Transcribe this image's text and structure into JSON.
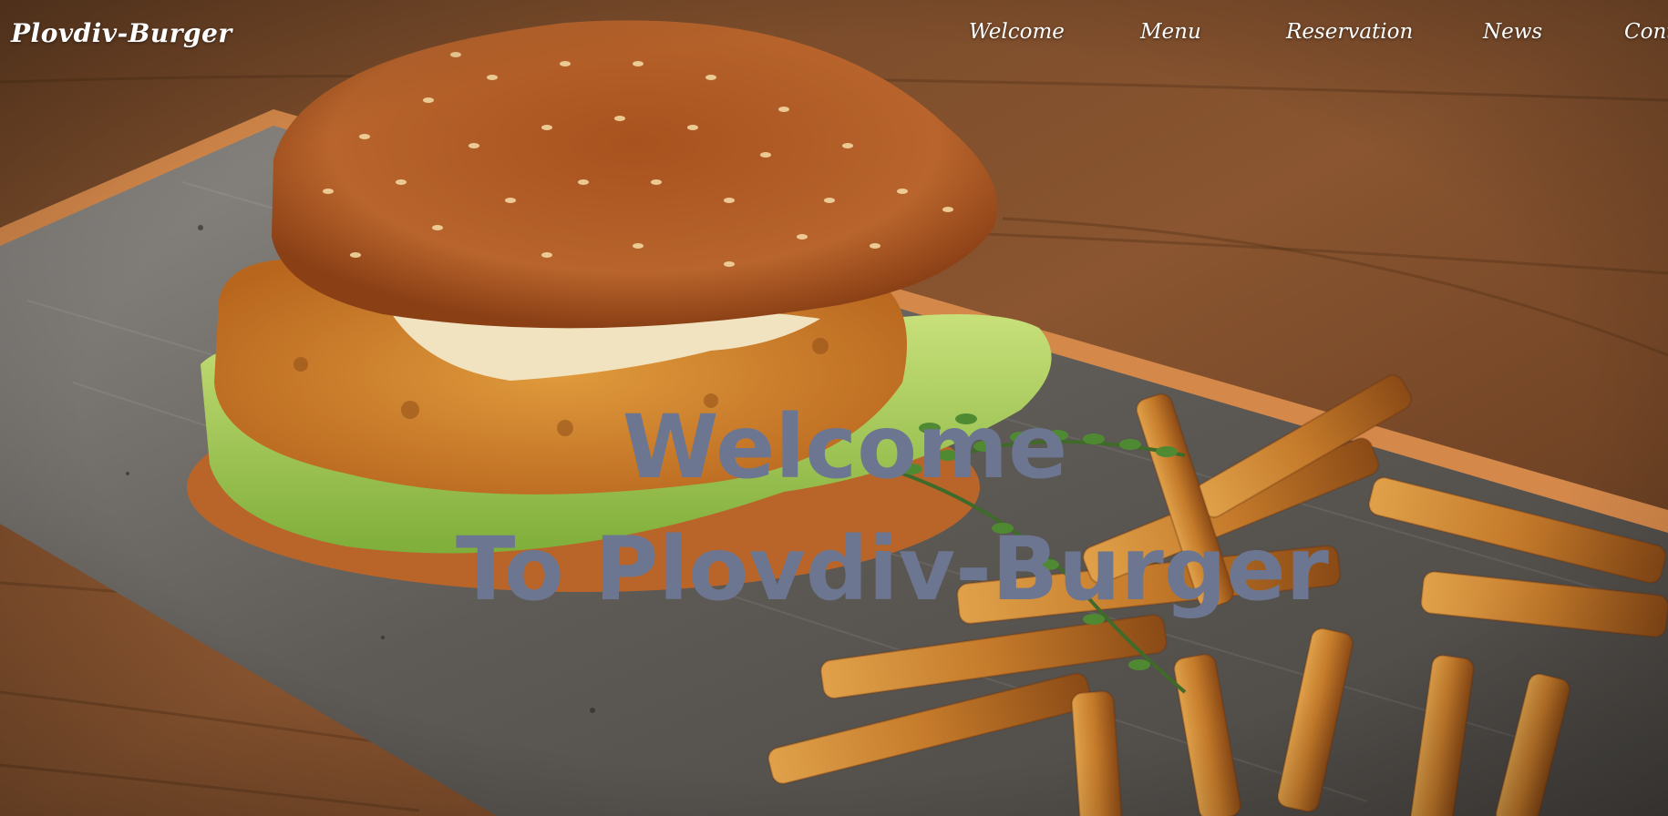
{
  "brand": {
    "logo_text": "Plovdiv-Burger"
  },
  "nav": {
    "items": [
      {
        "label": "Welcome"
      },
      {
        "label": "Menu"
      },
      {
        "label": "Reservation"
      },
      {
        "label": "News"
      },
      {
        "label": "Contact"
      }
    ]
  },
  "hero": {
    "headline_line1": "Welcome",
    "headline_line2": "To Plovdiv-Burger",
    "image_subject": "chicken burger with lettuce, sauce and french fries on a slate plate"
  },
  "colors": {
    "headline": "#6d7690",
    "nav_text": "#ffffff",
    "wood": "#7a4a28",
    "plate": "#6b6660"
  }
}
